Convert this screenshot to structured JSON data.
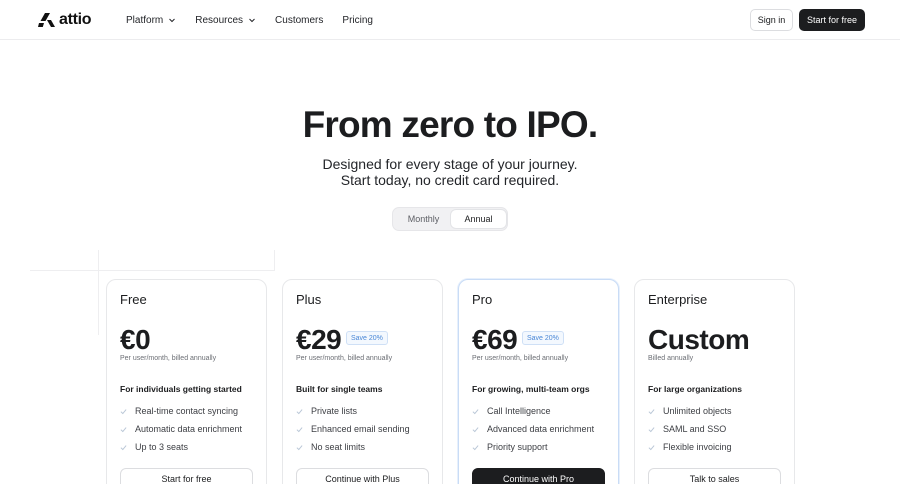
{
  "brand": {
    "name": "attio"
  },
  "nav": {
    "items": [
      {
        "label": "Platform",
        "dropdown": true
      },
      {
        "label": "Resources",
        "dropdown": true
      },
      {
        "label": "Customers",
        "dropdown": false
      },
      {
        "label": "Pricing",
        "dropdown": false
      }
    ],
    "sign_in": "Sign in",
    "start_free": "Start for free"
  },
  "hero": {
    "title": "From zero to IPO.",
    "subtitle_line1": "Designed for every stage of your journey.",
    "subtitle_line2": "Start today, no credit card required."
  },
  "billing_toggle": {
    "options": [
      "Monthly",
      "Annual"
    ],
    "selected": "Annual"
  },
  "plans": [
    {
      "name": "Free",
      "price": "€0",
      "badge": "",
      "billing": "Per user/month, billed annually",
      "for": "For individuals getting started",
      "features": [
        "Real-time contact syncing",
        "Automatic data enrichment",
        "Up to 3 seats"
      ],
      "cta": "Start for free"
    },
    {
      "name": "Plus",
      "price": "€29",
      "badge": "Save 20%",
      "billing": "Per user/month, billed annually",
      "for": "Built for single teams",
      "features": [
        "Private lists",
        "Enhanced email sending",
        "No seat limits"
      ],
      "cta": "Continue with Plus"
    },
    {
      "name": "Pro",
      "price": "€69",
      "badge": "Save 20%",
      "billing": "Per user/month, billed annually",
      "for": "For growing, multi-team orgs",
      "features": [
        "Call Intelligence",
        "Advanced data enrichment",
        "Priority support"
      ],
      "cta": "Continue with Pro"
    },
    {
      "name": "Enterprise",
      "price": "Custom",
      "badge": "",
      "billing": "Billed annually",
      "for": "For large organizations",
      "features": [
        "Unlimited objects",
        "SAML and SSO",
        "Flexible invoicing"
      ],
      "cta": "Talk to sales"
    }
  ],
  "colors": {
    "text": "#1c1d1f",
    "badge_text": "#4a87d6",
    "check": "#b9c6d6",
    "dark_button": "#1c1d1f"
  }
}
